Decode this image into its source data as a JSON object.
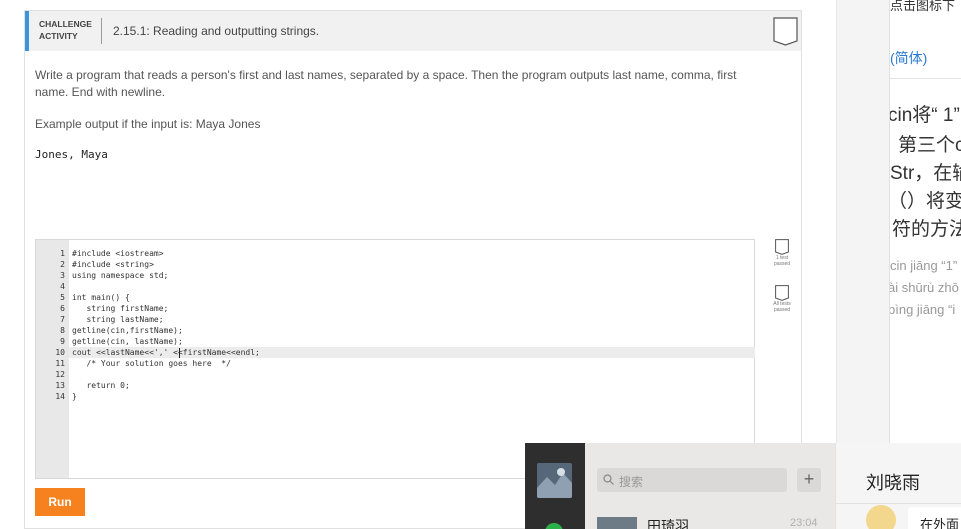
{
  "challenge": {
    "label_line1": "CHALLENGE",
    "label_line2": "ACTIVITY",
    "title": "2.15.1: Reading and outputting strings.",
    "description": "Write a program that reads a person's first and last names, separated by a space. Then the program outputs last name, comma, first name. End with newline.",
    "example_label": "Example output if the input is: Maya Jones",
    "example_output": "Jones, Maya"
  },
  "editor": {
    "lines": [
      {
        "num": "1",
        "code": "#include <iostream>"
      },
      {
        "num": "2",
        "code": "#include <string>"
      },
      {
        "num": "3",
        "code": "using namespace std;"
      },
      {
        "num": "4",
        "code": ""
      },
      {
        "num": "5",
        "code": "int main() {"
      },
      {
        "num": "6",
        "code": "   string firstName;"
      },
      {
        "num": "7",
        "code": "   string lastName;"
      },
      {
        "num": "8",
        "code": "getline(cin,firstName);"
      },
      {
        "num": "9",
        "code": "getline(cin, lastName);"
      },
      {
        "num": "10",
        "code": "cout <<lastName<<',' <<firstName<<endl;"
      },
      {
        "num": "11",
        "code": "   /* Your solution goes here  */"
      },
      {
        "num": "12",
        "code": ""
      },
      {
        "num": "13",
        "code": "   return 0;"
      },
      {
        "num": "14",
        "code": "}"
      }
    ]
  },
  "tests": {
    "test1": "1 test passed",
    "all": "All tests passed"
  },
  "run_label": "Run",
  "right_panel": {
    "top_text": "点击图标下",
    "tab_label": "(简体)",
    "lines_big": [
      "cin将“ 1”",
      "第三个c",
      "Str，在输",
      "（）将变",
      "符的方法"
    ],
    "lines_small": [
      "cin jiāng “1”",
      "ài shūrù zhō",
      "bìng jiāng “i"
    ]
  },
  "chat": {
    "search_placeholder": "搜索",
    "add_symbol": "+",
    "contact_name": "田琦羽",
    "contact_time": "23:04",
    "conversation_title": "刘晓雨",
    "last_message": "在外面"
  },
  "colors": {
    "accent_blue": "#3a96d9",
    "run_orange": "#f5821f",
    "link_blue": "#2a7ad6",
    "chat_dark": "#2e2e2e"
  }
}
